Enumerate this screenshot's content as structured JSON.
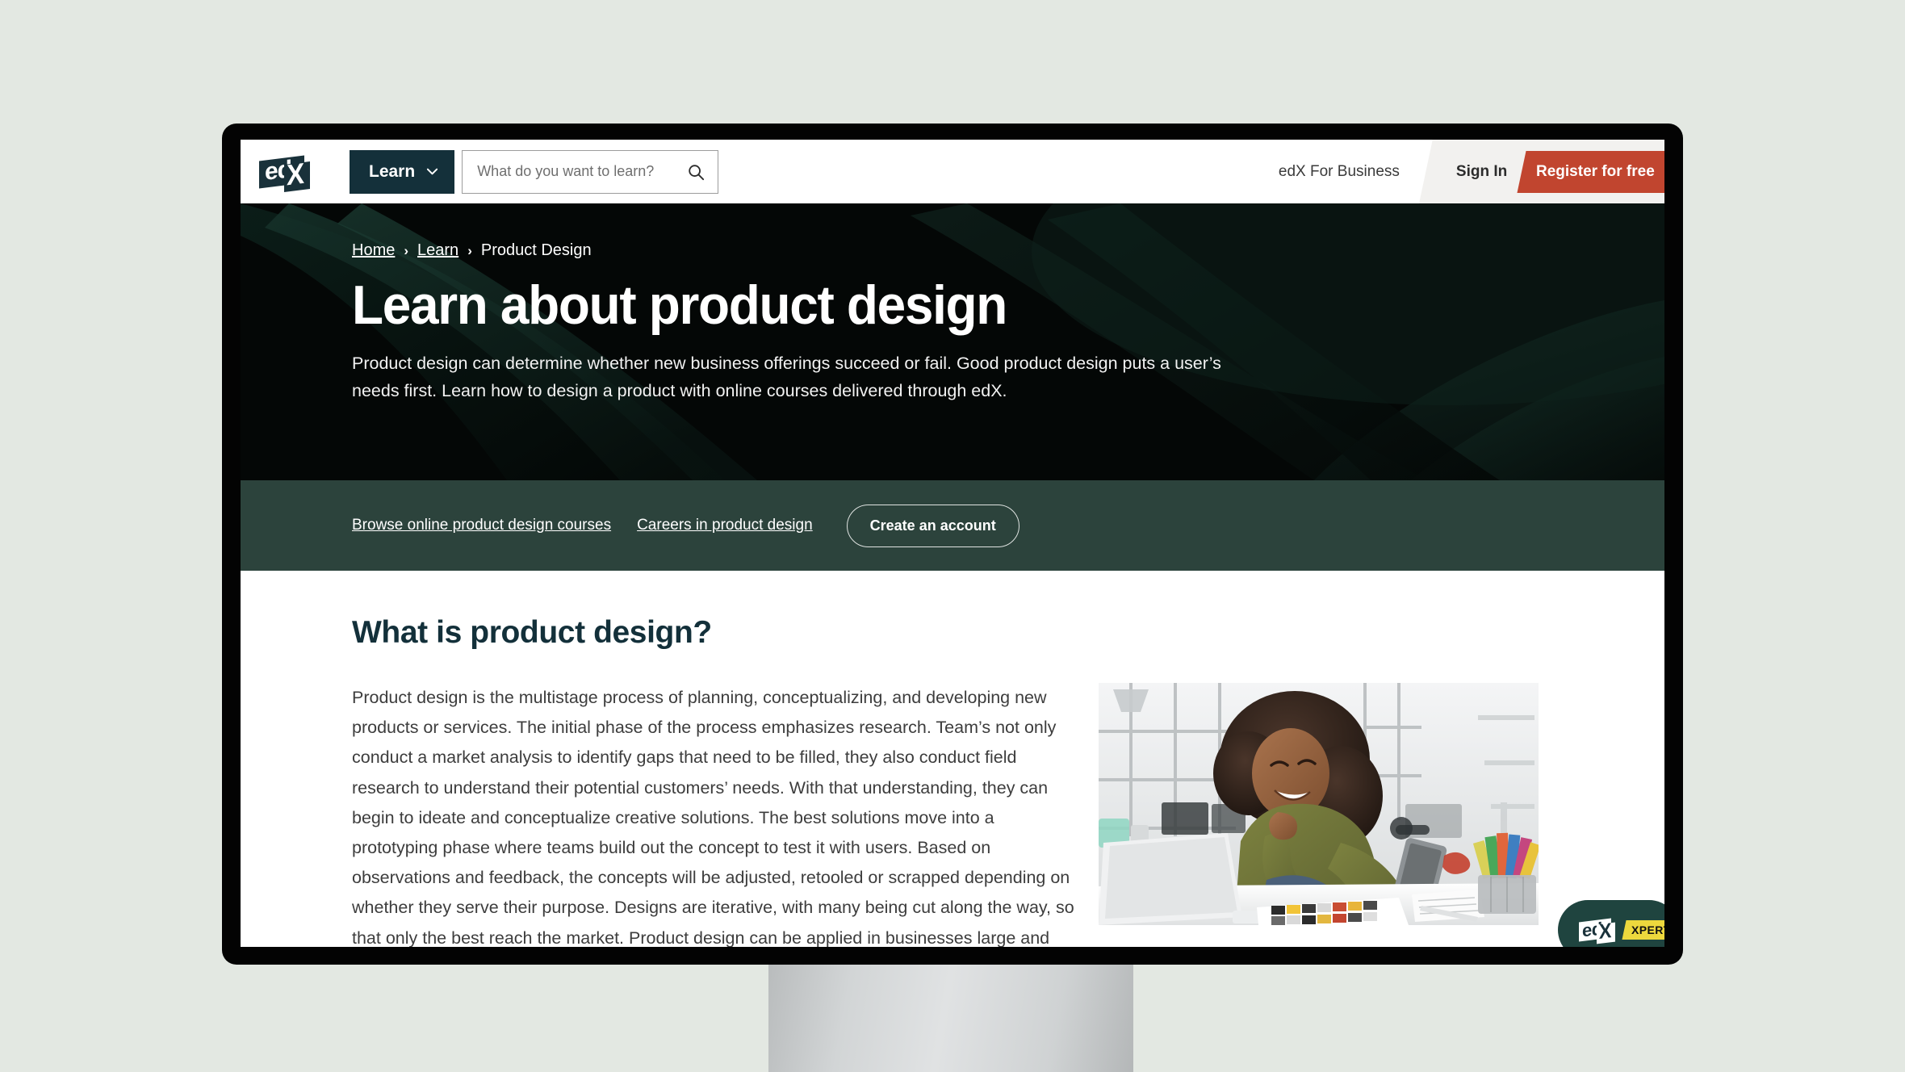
{
  "brand": {
    "logo_text_primary": "ed",
    "logo_text_secondary": "X",
    "accent_red": "#c1452f",
    "dark_teal": "#14303a",
    "bar_green": "#2c433c",
    "heading_color": "#13303a",
    "page_background": "#e3e8e2"
  },
  "topnav": {
    "learn_label": "Learn",
    "chevron_icon": "chevron-down-icon",
    "search_placeholder": "What do you want to learn?",
    "search_value": "",
    "search_icon": "search-icon",
    "business_link": "edX For Business",
    "sign_in_label": "Sign In",
    "register_label": "Register for free"
  },
  "hero": {
    "breadcrumb": [
      {
        "label": "Home",
        "link": true
      },
      {
        "label": "Learn",
        "link": true
      },
      {
        "label": "Product Design",
        "link": false
      }
    ],
    "separator": "›",
    "title": "Learn about product design",
    "description": "Product design can determine whether new business offerings succeed or fail. Good product design puts a user’s needs first. Learn how to design a product with online courses delivered through edX."
  },
  "actionbar": {
    "links": [
      "Browse online product design courses",
      "Careers in product design"
    ],
    "button_label": "Create an account"
  },
  "content": {
    "heading": "What is product design?",
    "paragraph": "Product design is the multistage process of planning, conceptualizing, and developing new products or services. The initial phase of the process emphasizes research. Team’s not only conduct a market analysis to identify gaps that need to be filled, they also conduct field research to understand their potential customers’ needs. With that understanding, they can begin to ideate and conceptualize creative solutions. The best solutions move into a prototyping phase where teams build out the concept to test it with users. Based on observations and feedback, the concepts will be adjusted, retooled or scrapped depending on whether they serve their purpose. Designs are iterative, with many being cut along the way, so that only the best reach the market. Product design can be applied in businesses large and small, across",
    "photo_alt": "Smiling woman with afro in olive sweater leaning on desk holding a tablet beside a laptop, color swatches and colored pencils"
  },
  "xpert": {
    "logo_text_primary": "ed",
    "logo_text_secondary": "X",
    "tag_label": "XPERT"
  }
}
